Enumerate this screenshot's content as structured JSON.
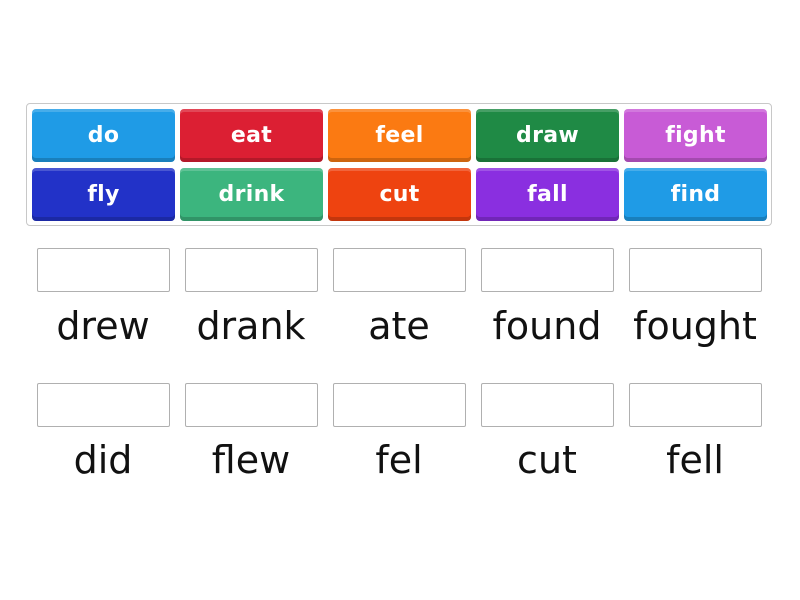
{
  "tiles": [
    {
      "label": "do",
      "color": "#1f9be6"
    },
    {
      "label": "eat",
      "color": "#dc1f33"
    },
    {
      "label": "feel",
      "color": "#fb7a12"
    },
    {
      "label": "draw",
      "color": "#1f8a45"
    },
    {
      "label": "fight",
      "color": "#c85bd6"
    },
    {
      "label": "fly",
      "color": "#2232c8"
    },
    {
      "label": "drink",
      "color": "#3cb57e"
    },
    {
      "label": "cut",
      "color": "#ee4310"
    },
    {
      "label": "fall",
      "color": "#8a2fe0"
    },
    {
      "label": "find",
      "color": "#1f9be6"
    }
  ],
  "targets": [
    {
      "label": "drew",
      "value": ""
    },
    {
      "label": "drank",
      "value": ""
    },
    {
      "label": "ate",
      "value": ""
    },
    {
      "label": "found",
      "value": ""
    },
    {
      "label": "fought",
      "value": ""
    },
    {
      "label": "did",
      "value": ""
    },
    {
      "label": "flew",
      "value": ""
    },
    {
      "label": "fel",
      "value": ""
    },
    {
      "label": "cut",
      "value": ""
    },
    {
      "label": "fell",
      "value": ""
    }
  ]
}
